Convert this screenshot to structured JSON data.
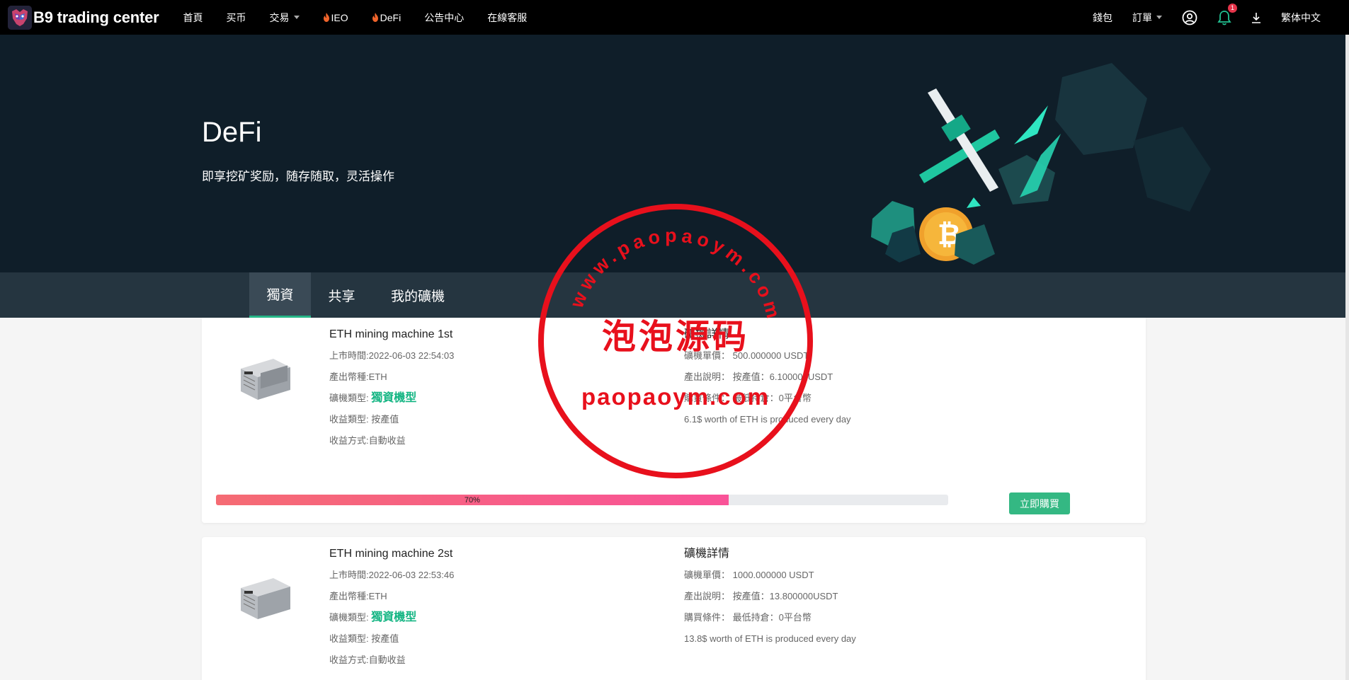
{
  "brand": {
    "name": "B9 trading center"
  },
  "nav": {
    "items": [
      {
        "label": "首頁"
      },
      {
        "label": "买币"
      },
      {
        "label": "交易",
        "dropdown": true
      },
      {
        "label": "IEO",
        "fire": true
      },
      {
        "label": "DeFi",
        "fire": true
      },
      {
        "label": "公告中心"
      },
      {
        "label": "在線客服"
      }
    ],
    "right": {
      "wallet": "錢包",
      "orders": "訂單",
      "notifications_count": "1",
      "language": "繁体中文"
    }
  },
  "hero": {
    "title": "DeFi",
    "subtitle": "即享挖矿奖励，随存随取，灵活操作"
  },
  "tabs": [
    {
      "label": "獨資",
      "active": true
    },
    {
      "label": "共享",
      "active": false
    },
    {
      "label": "我的礦機",
      "active": false
    }
  ],
  "machines": [
    {
      "name": "ETH mining machine 1st",
      "listed_label": "上市時間:",
      "listed_value": "2022-06-03 22:54:03",
      "currency_label": "產出幣種:",
      "currency_value": "ETH",
      "type_label": "礦機類型:",
      "type_value": "獨資機型",
      "revenue_type_label": "收益類型:",
      "revenue_type_value": "按產值",
      "revenue_method_label": "收益方式:",
      "revenue_method_value": "自動收益",
      "details_title": "礦機詳情",
      "unit_price_label": "礦機單價：",
      "unit_price_value": "500.000000 USDT",
      "output_label": "產出說明：",
      "output_value": "按產值：6.100000USDT",
      "purchase_label": "購買條件：",
      "purchase_value": "最低持倉：0平台幣",
      "note": "6.1$ worth of ETH is produced every day",
      "progress": 70,
      "progress_text": "70%",
      "buy_label": "立即購買"
    },
    {
      "name": "ETH mining machine 2st",
      "listed_label": "上市時間:",
      "listed_value": "2022-06-03 22:53:46",
      "currency_label": "產出幣種:",
      "currency_value": "ETH",
      "type_label": "礦機類型:",
      "type_value": "獨資機型",
      "revenue_type_label": "收益類型:",
      "revenue_type_value": "按產值",
      "revenue_method_label": "收益方式:",
      "revenue_method_value": "自動收益",
      "details_title": "礦機詳情",
      "unit_price_label": "礦機單價：",
      "unit_price_value": "1000.000000 USDT",
      "output_label": "產出說明：",
      "output_value": "按產值：13.800000USDT",
      "purchase_label": "購買條件：",
      "purchase_value": "最低持倉：0平台幣",
      "note": "13.8$ worth of ETH is produced every day"
    }
  ],
  "watermark": {
    "top_text": "www.paopaoym.com",
    "middle_text": "泡泡源码",
    "bottom_text": "paopaoym.com"
  },
  "colors": {
    "accent": "#34b883",
    "nav_bg": "#000000",
    "hero_bg": "#0f1e29",
    "tabs_bg": "#253540",
    "progress_start": "#f56b73",
    "progress_end": "#f95398",
    "stamp": "#e8101c"
  },
  "icons": [
    "logo-icon",
    "fire-icon",
    "caret-down-icon",
    "user-icon",
    "bell-icon",
    "download-icon",
    "miner-icon"
  ]
}
